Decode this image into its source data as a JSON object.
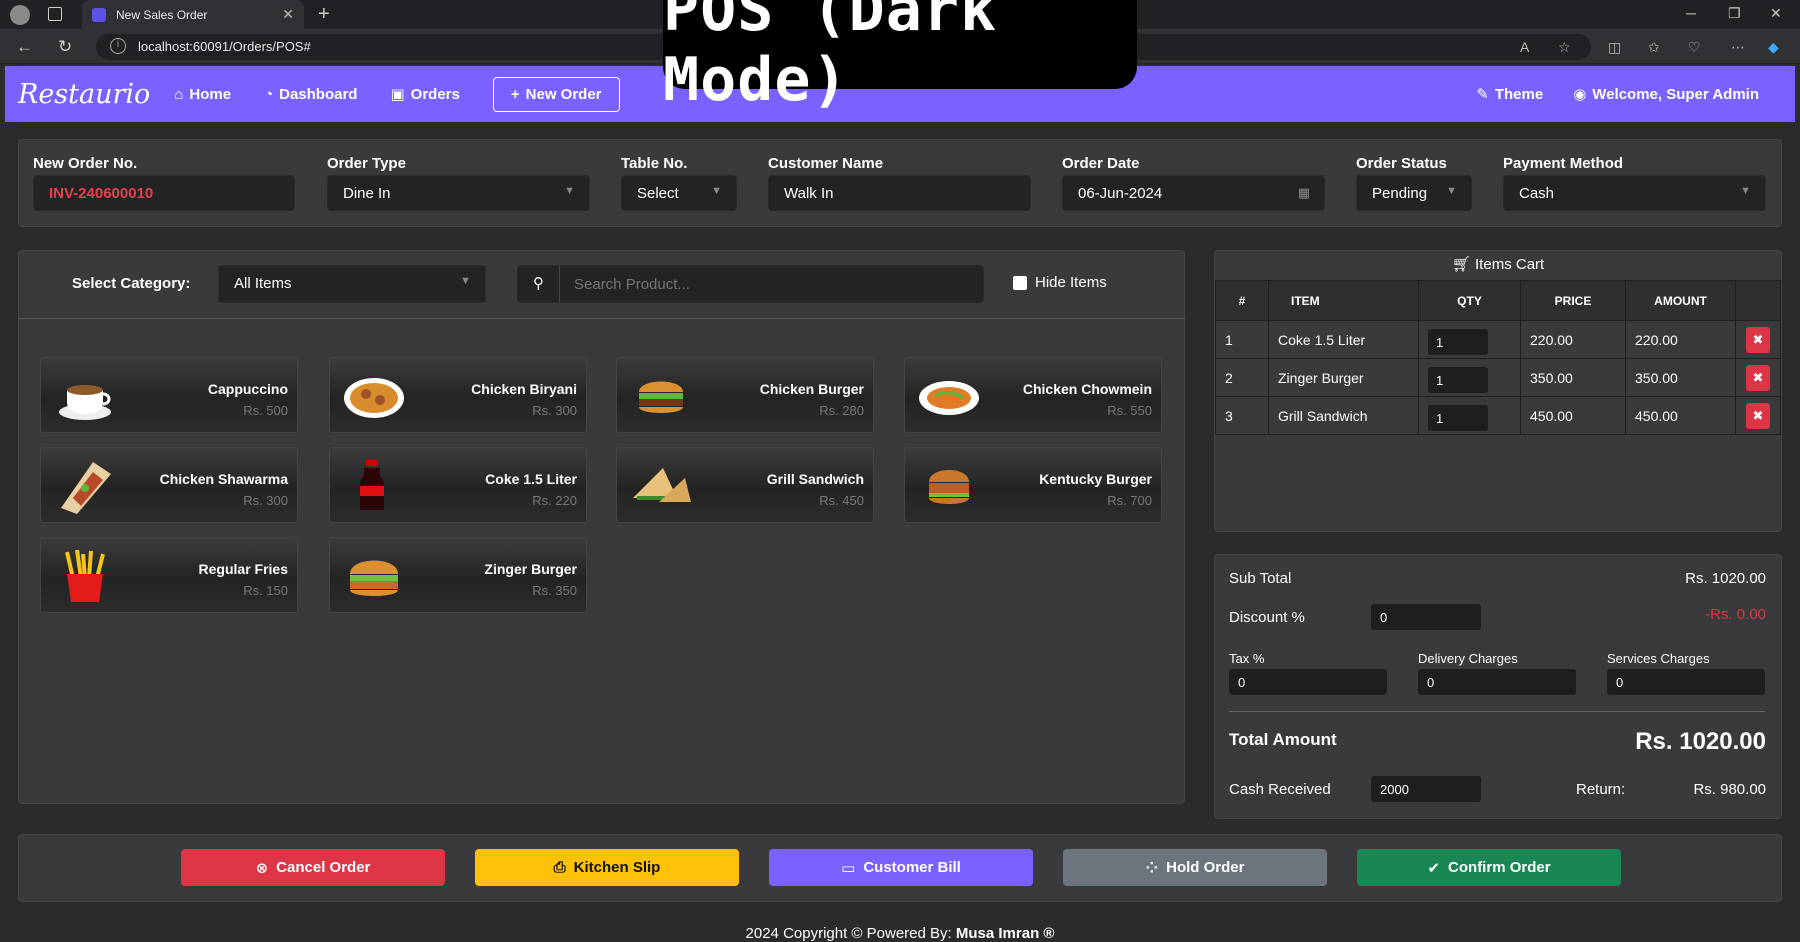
{
  "browser": {
    "tab_title": "New Sales Order",
    "url": "localhost:60091/Orders/POS#"
  },
  "banner": "POS (Dark Mode)",
  "nav": {
    "brand": "Restaurio",
    "home": "Home",
    "dashboard": "Dashboard",
    "orders": "Orders",
    "new_order": "New Order",
    "theme": "Theme",
    "welcome": "Welcome, Super Admin"
  },
  "order": {
    "no_label": "New Order No.",
    "no_value": "INV-240600010",
    "type_label": "Order Type",
    "type_value": "Dine In",
    "table_label": "Table No.",
    "table_value": "Select",
    "customer_label": "Customer Name",
    "customer_value": "Walk In",
    "date_label": "Order Date",
    "date_value": "06-Jun-2024",
    "status_label": "Order Status",
    "status_value": "Pending",
    "payment_label": "Payment Method",
    "payment_value": "Cash"
  },
  "filters": {
    "category_label": "Select Category:",
    "category_value": "All Items",
    "search_placeholder": "Search Product...",
    "hide_label": "Hide Items"
  },
  "products": [
    {
      "name": "Cappuccino",
      "price": "Rs. 500"
    },
    {
      "name": "Chicken Biryani",
      "price": "Rs. 300"
    },
    {
      "name": "Chicken Burger",
      "price": "Rs. 280"
    },
    {
      "name": "Chicken Chowmein",
      "price": "Rs. 550"
    },
    {
      "name": "Chicken Shawarma",
      "price": "Rs. 300"
    },
    {
      "name": "Coke 1.5 Liter",
      "price": "Rs. 220"
    },
    {
      "name": "Grill Sandwich",
      "price": "Rs. 450"
    },
    {
      "name": "Kentucky Burger",
      "price": "Rs. 700"
    },
    {
      "name": "Regular Fries",
      "price": "Rs. 150"
    },
    {
      "name": "Zinger Burger",
      "price": "Rs. 350"
    }
  ],
  "cart": {
    "title": "Items Cart",
    "headers": [
      "#",
      "ITEM",
      "QTY",
      "PRICE",
      "AMOUNT"
    ],
    "rows": [
      {
        "n": "1",
        "item": "Coke 1.5 Liter",
        "qty": "1",
        "price": "220.00",
        "amount": "220.00"
      },
      {
        "n": "2",
        "item": "Zinger Burger",
        "qty": "1",
        "price": "350.00",
        "amount": "350.00"
      },
      {
        "n": "3",
        "item": "Grill Sandwich",
        "qty": "1",
        "price": "450.00",
        "amount": "450.00"
      }
    ]
  },
  "summary": {
    "subtotal_label": "Sub Total",
    "subtotal_value": "Rs. 1020.00",
    "discount_label": "Discount %",
    "discount_input": "0",
    "discount_value": "-Rs. 0.00",
    "tax_label": "Tax %",
    "tax_input": "0",
    "delivery_label": "Delivery Charges",
    "delivery_input": "0",
    "services_label": "Services Charges",
    "services_input": "0",
    "total_label": "Total Amount",
    "total_value": "Rs. 1020.00",
    "cash_label": "Cash Received",
    "cash_input": "2000",
    "return_label": "Return:",
    "return_value": "Rs. 980.00"
  },
  "actions": {
    "cancel": "Cancel Order",
    "kitchen": "Kitchen Slip",
    "bill": "Customer Bill",
    "hold": "Hold Order",
    "confirm": "Confirm Order"
  },
  "footer": {
    "text": "2024 Copyright © Powered By: ",
    "author": "Musa Imran ®"
  },
  "colors": {
    "accent": "#7b61ff",
    "danger": "#dc3545",
    "warning": "#ffc107",
    "secondary": "#6c757d",
    "success": "#198754"
  }
}
